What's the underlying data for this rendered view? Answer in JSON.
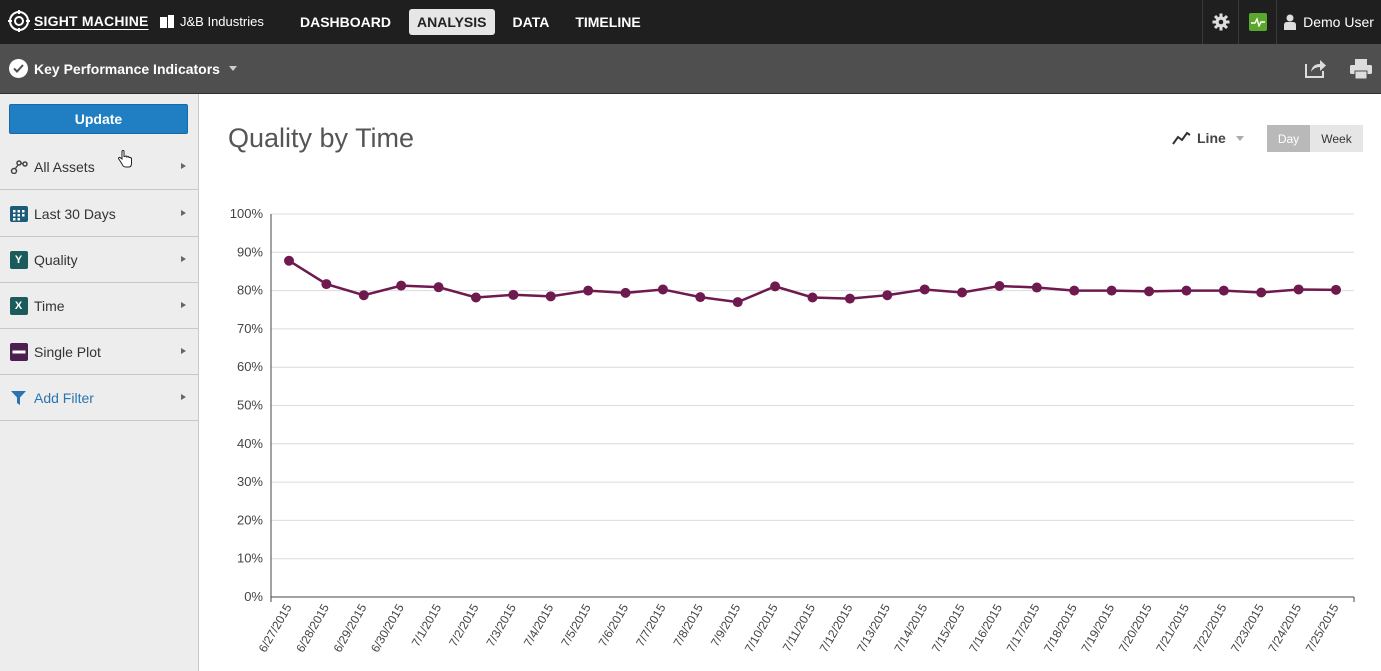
{
  "topbar": {
    "logo_text": "SIGHT MACHINE",
    "company": "J&B Industries",
    "nav": [
      "DASHBOARD",
      "ANALYSIS",
      "DATA",
      "TIMELINE"
    ],
    "active_nav": "ANALYSIS",
    "user": "Demo User",
    "icons": [
      "gear-icon",
      "pulse-icon",
      "user-icon"
    ]
  },
  "subbar": {
    "title": "Key Performance Indicators",
    "icons": [
      "check-icon",
      "share-icon",
      "print-icon"
    ]
  },
  "sidebar": {
    "update_label": "Update",
    "items": [
      {
        "label": "All Assets",
        "icon": "assets-icon"
      },
      {
        "label": "Last 30 Days",
        "icon": "calendar-icon"
      },
      {
        "label": "Quality",
        "icon": "y-axis-icon",
        "badge": "Y"
      },
      {
        "label": "Time",
        "icon": "x-axis-icon",
        "badge": "X"
      },
      {
        "label": "Single Plot",
        "icon": "single-plot-icon"
      },
      {
        "label": "Add Filter",
        "icon": "filter-icon"
      }
    ]
  },
  "main": {
    "chart_type_label": "Line",
    "period": {
      "day": "Day",
      "week": "Week",
      "selected": "Day"
    }
  },
  "colors": {
    "series": "#6e1a4e",
    "accent_blue": "#1f7fc2",
    "topbar": "#1f1f1f",
    "subbar": "#4f4f4f",
    "status_green": "#5ba72e"
  },
  "chart_data": {
    "type": "line",
    "title": "Quality by Time",
    "xlabel": "",
    "ylabel": "",
    "ylim": [
      0,
      100
    ],
    "yticks": [
      "0%",
      "10%",
      "20%",
      "30%",
      "40%",
      "50%",
      "60%",
      "70%",
      "80%",
      "90%",
      "100%"
    ],
    "grid": true,
    "x": [
      "6/27/2015",
      "6/28/2015",
      "6/29/2015",
      "6/30/2015",
      "7/1/2015",
      "7/2/2015",
      "7/3/2015",
      "7/4/2015",
      "7/5/2015",
      "7/6/2015",
      "7/7/2015",
      "7/8/2015",
      "7/9/2015",
      "7/10/2015",
      "7/11/2015",
      "7/12/2015",
      "7/13/2015",
      "7/14/2015",
      "7/15/2015",
      "7/16/2015",
      "7/17/2015",
      "7/18/2015",
      "7/19/2015",
      "7/20/2015",
      "7/21/2015",
      "7/22/2015",
      "7/23/2015",
      "7/24/2015",
      "7/25/2015"
    ],
    "series": [
      {
        "values": [
          87.8,
          81.7,
          78.8,
          81.3,
          80.9,
          78.2,
          78.9,
          78.5,
          80.0,
          79.4,
          80.3,
          78.3,
          77.0,
          81.1,
          78.2,
          77.9,
          78.8,
          80.3,
          79.5,
          81.2,
          80.8,
          80.0,
          80.0,
          79.8,
          80.0,
          80.0,
          79.5,
          80.3,
          80.2
        ]
      }
    ]
  }
}
